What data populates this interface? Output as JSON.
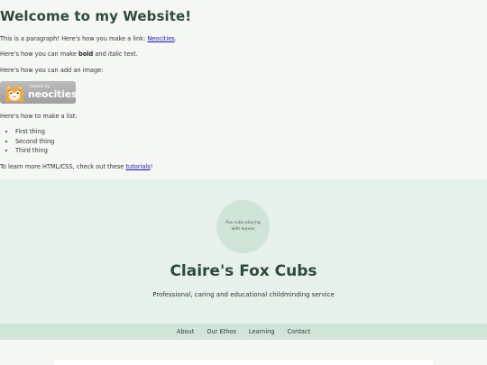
{
  "intro": {
    "heading": "Welcome to my Website!",
    "p1_prefix": "This is a paragraph! Here's how you make a link: ",
    "p1_link": "Neocities",
    "p1_suffix": ".",
    "p2_prefix": "Here's how you can make ",
    "p2_bold": "bold",
    "p2_mid": " and ",
    "p2_italic": "italic",
    "p2_suffix": " text.",
    "p3": "Here's how you can add an image:",
    "badge_small": "hosted by",
    "badge_big": "neocities",
    "p4": "Here's how to make a list:",
    "list": [
      "First thing",
      "Second thing",
      "Third thing"
    ],
    "p5_prefix": "To learn more HTML/CSS, check out these ",
    "p5_link": "tutorials",
    "p5_suffix": "!"
  },
  "hero": {
    "image_alt": "Fox cubs playing with leaves",
    "title": "Claire's Fox Cubs",
    "subtitle": "Professional, caring and educational childminding service"
  },
  "nav": {
    "items": [
      "About",
      "Our Ethos",
      "Learning",
      "Contact"
    ]
  },
  "colors": {
    "heading": "#2f4a3a",
    "hero_bg": "#e5f1ea",
    "nav_bg": "#d0e4d7",
    "link": "#1a1aa6"
  },
  "icons": {
    "badge": "neocities-cat-icon"
  }
}
